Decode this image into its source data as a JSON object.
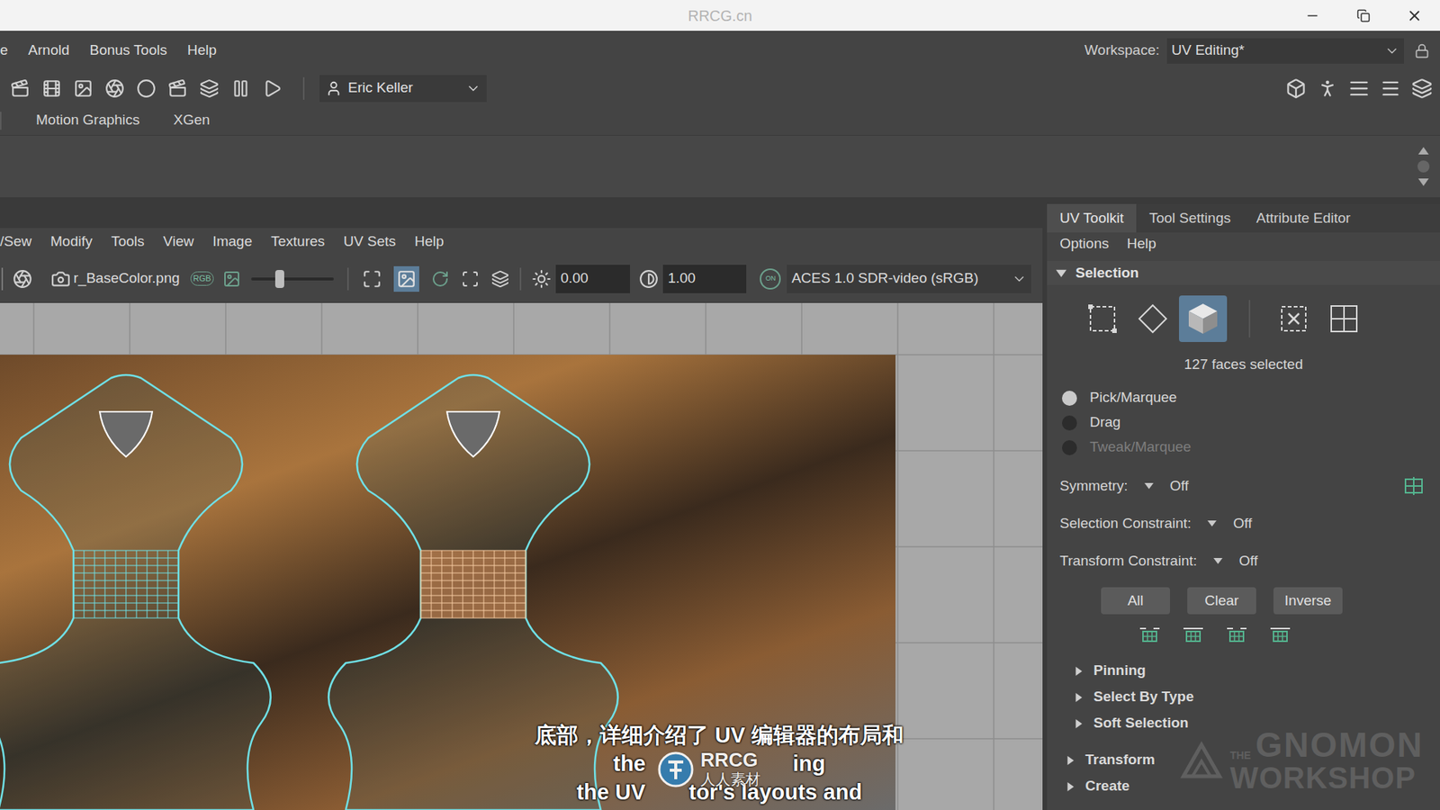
{
  "window": {
    "title": "RRCG.cn"
  },
  "menubar": {
    "items": [
      "e",
      "Arnold",
      "Bonus Tools",
      "Help"
    ],
    "workspace_label": "Workspace:",
    "workspace": "UV Editing*"
  },
  "toolbar": {
    "user": "Eric Keller"
  },
  "shelf": {
    "tabs": [
      "Motion Graphics",
      "XGen"
    ]
  },
  "uv_editor": {
    "menu": [
      "/Sew",
      "Modify",
      "Tools",
      "View",
      "Image",
      "Textures",
      "UV Sets",
      "Help"
    ],
    "image": "r_BaseColor.png",
    "channel": "RGB",
    "slider_level": 0.34,
    "exposure": "0.00",
    "gamma": "1.00",
    "color_management": "ON",
    "view_transform": "ACES 1.0 SDR-video (sRGB)"
  },
  "subtitles": {
    "lines": [
      [
        "底部，详细介绍了 UV 编辑器的布局和"
      ],
      [
        "the",
        "ing"
      ],
      [
        "the UV",
        "tor's layouts and"
      ]
    ]
  },
  "watermark": {
    "brand": "RRCG",
    "sub": "人人素材"
  },
  "uv_toolkit": {
    "tabs": [
      {
        "label": "UV Toolkit",
        "selected": true
      },
      {
        "label": "Tool Settings",
        "selected": false
      },
      {
        "label": "Attribute Editor",
        "selected": false
      }
    ],
    "menu": [
      "Options",
      "Help"
    ],
    "section": {
      "title": "Selection",
      "expanded": true
    },
    "modes": [
      {
        "kind": "uv",
        "selected": false
      },
      {
        "kind": "edge",
        "selected": false
      },
      {
        "kind": "face",
        "selected": true
      },
      {
        "kind": "shell",
        "selected": false
      },
      {
        "kind": "grid",
        "selected": false
      }
    ],
    "status": "127 faces selected",
    "radios": [
      {
        "label": "Pick/Marquee",
        "selected": true,
        "disabled": false
      },
      {
        "label": "Drag",
        "selected": false,
        "disabled": false
      },
      {
        "label": "Tweak/Marquee",
        "selected": false,
        "disabled": true
      }
    ],
    "constraints": [
      {
        "label": "Symmetry:",
        "value": "Off"
      },
      {
        "label": "Selection Constraint:",
        "value": "Off"
      },
      {
        "label": "Transform Constraint:",
        "value": "Off"
      }
    ],
    "buttons": [
      "All",
      "Clear",
      "Inverse"
    ],
    "subsections": [
      {
        "title": "Pinning",
        "expanded": false
      },
      {
        "title": "Select By Type",
        "expanded": false
      },
      {
        "title": "Soft Selection",
        "expanded": false
      }
    ],
    "sections": [
      {
        "title": "Transform",
        "expanded": false
      },
      {
        "title": "Create",
        "expanded": false
      }
    ]
  },
  "branding": {
    "the": "THE",
    "name": "GNOMON",
    "sub": "WORKSHOP"
  }
}
